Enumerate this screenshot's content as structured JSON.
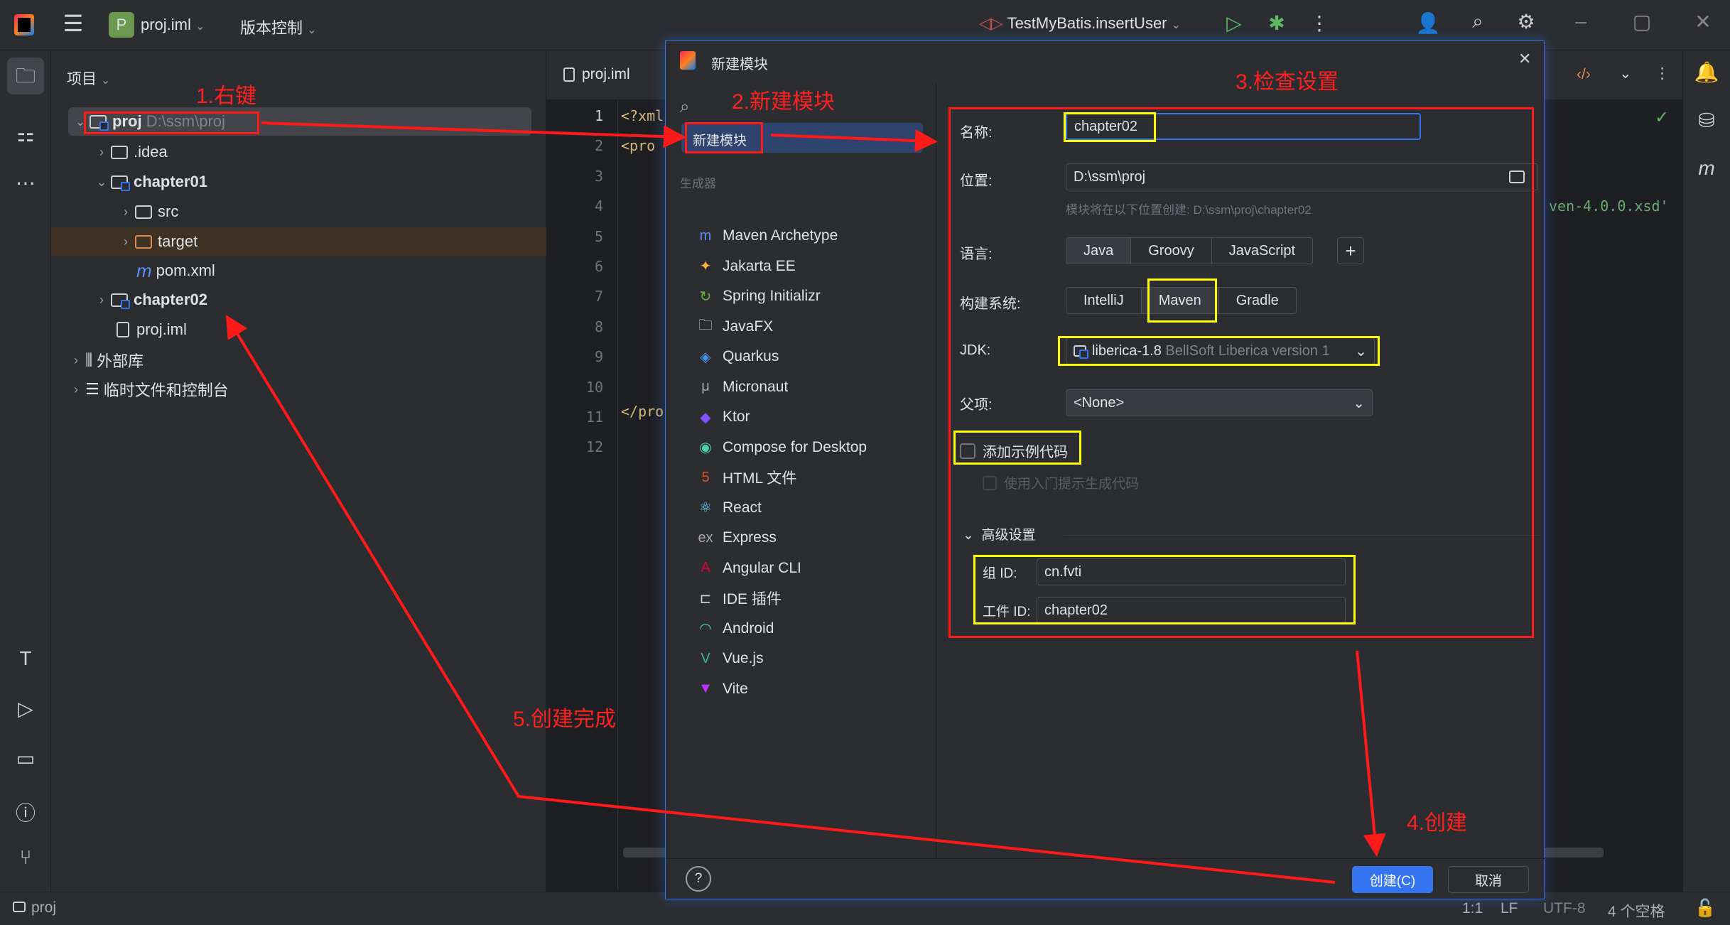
{
  "titlebar": {
    "project_badge": "P",
    "project_name": "proj.iml",
    "vcs": "版本控制",
    "run_config": "TestMyBatis.insertUser"
  },
  "project_panel": {
    "title": "项目",
    "tree": [
      {
        "label": "proj",
        "hint": "D:\\ssm\\proj",
        "type": "module",
        "expanded": true,
        "depth": 0,
        "bold": true
      },
      {
        "label": ".idea",
        "type": "folder",
        "depth": 1
      },
      {
        "label": "chapter01",
        "type": "module",
        "expanded": true,
        "depth": 1
      },
      {
        "label": "src",
        "type": "folder",
        "depth": 2
      },
      {
        "label": "target",
        "type": "folder-excluded",
        "depth": 2
      },
      {
        "label": "pom.xml",
        "type": "maven",
        "depth": 2
      },
      {
        "label": "chapter02",
        "type": "module",
        "depth": 1
      },
      {
        "label": "proj.iml",
        "type": "file",
        "depth": 1
      },
      {
        "label": "外部库",
        "type": "library",
        "depth": 0
      },
      {
        "label": "临时文件和控制台",
        "type": "scratch",
        "depth": 0
      }
    ]
  },
  "editor": {
    "tab": "proj.iml",
    "line_numbers": [
      "1",
      "2",
      "3",
      "4",
      "5",
      "6",
      "7",
      "8",
      "9",
      "10",
      "11",
      "12"
    ],
    "code_line1": "<?xml",
    "code_line2": "<pro",
    "code_line12": "</pro",
    "code_right": "ven-4.0.0.xsd'"
  },
  "dialog": {
    "title": "新建模块",
    "selected": "新建模块",
    "generators_header": "生成器",
    "generators": [
      "Maven Archetype",
      "Jakarta EE",
      "Spring Initializr",
      "JavaFX",
      "Quarkus",
      "Micronaut",
      "Ktor",
      "Compose for Desktop",
      "HTML 文件",
      "React",
      "Express",
      "Angular CLI",
      "IDE 插件",
      "Android",
      "Vue.js",
      "Vite"
    ],
    "form": {
      "name_label": "名称:",
      "name_value": "chapter02",
      "location_label": "位置:",
      "location_value": "D:\\ssm\\proj",
      "location_hint": "模块将在以下位置创建: D:\\ssm\\proj\\chapter02",
      "language_label": "语言:",
      "languages": [
        "Java",
        "Groovy",
        "JavaScript"
      ],
      "language_selected": "Java",
      "build_label": "构建系统:",
      "builds": [
        "IntelliJ",
        "Maven",
        "Gradle"
      ],
      "build_selected": "Maven",
      "jdk_label": "JDK:",
      "jdk_value": "liberica-1.8",
      "jdk_detail": "BellSoft Liberica version 1",
      "parent_label": "父项:",
      "parent_value": "<None>",
      "sample_code_label": "添加示例代码",
      "sample_code_checked": false,
      "onboarding_label": "使用入门提示生成代码",
      "advanced_label": "高级设置",
      "group_label": "组 ID:",
      "group_value": "cn.fvti",
      "artifact_label": "工件 ID:",
      "artifact_value": "chapter02"
    },
    "create_button": "创建(C)",
    "cancel_button": "取消",
    "help": "?"
  },
  "annotations": {
    "step1": "1.右键",
    "step2": "2.新建模块",
    "step3": "3.检查设置",
    "step4": "4.创建",
    "step5": "5.创建完成"
  },
  "statusbar": {
    "breadcrumb": "proj",
    "position": "1:1",
    "line_sep": "LF",
    "encoding": "UTF-8",
    "indent": "4 个空格"
  },
  "colors": {
    "accent": "#3574f0",
    "annotation_red": "#ff1a1a",
    "highlight_yellow": "#ffff00"
  }
}
